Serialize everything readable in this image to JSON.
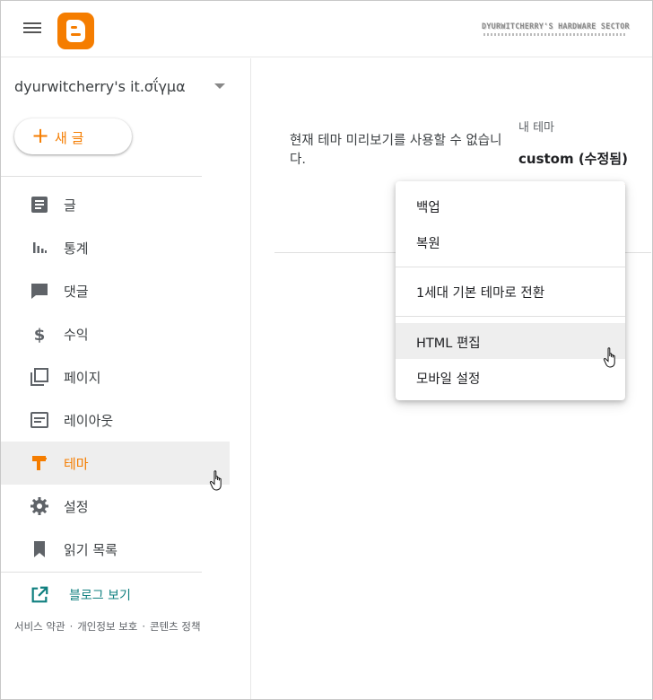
{
  "header": {
    "brand_text": "DYURWITCHERRY'S HARDWARE SECTOR"
  },
  "sidebar": {
    "blog_name": "dyurwitcherry's it.σΐγμα",
    "new_post_label": "새 글",
    "items": [
      {
        "label": "글",
        "icon": "posts-icon"
      },
      {
        "label": "통계",
        "icon": "stats-icon"
      },
      {
        "label": "댓글",
        "icon": "comments-icon"
      },
      {
        "label": "수익",
        "icon": "earnings-icon"
      },
      {
        "label": "페이지",
        "icon": "pages-icon"
      },
      {
        "label": "레이아웃",
        "icon": "layout-icon"
      },
      {
        "label": "테마",
        "icon": "theme-icon",
        "active": true
      },
      {
        "label": "설정",
        "icon": "settings-icon"
      },
      {
        "label": "읽기 목록",
        "icon": "reading-list-icon"
      }
    ],
    "view_blog_label": "블로그 보기",
    "footer": {
      "terms": "서비스 약관",
      "privacy": "개인정보 보호",
      "content_policy": "콘텐츠 정책",
      "separator": "·"
    }
  },
  "main": {
    "preview_message": "현재 테마 미리보기를 사용할 수 없습니다.",
    "my_theme_label": "내 테마",
    "theme_name": "custom (수정됨)"
  },
  "menu": {
    "items": [
      {
        "label": "백업"
      },
      {
        "label": "복원"
      },
      {
        "label": "1세대 기본 테마로 전환"
      },
      {
        "label": "HTML 편집",
        "hovered": true
      },
      {
        "label": "모바일 설정"
      }
    ]
  },
  "colors": {
    "accent": "#f57d00",
    "link": "#0f7f7f",
    "active_bg": "#eeeeee"
  }
}
